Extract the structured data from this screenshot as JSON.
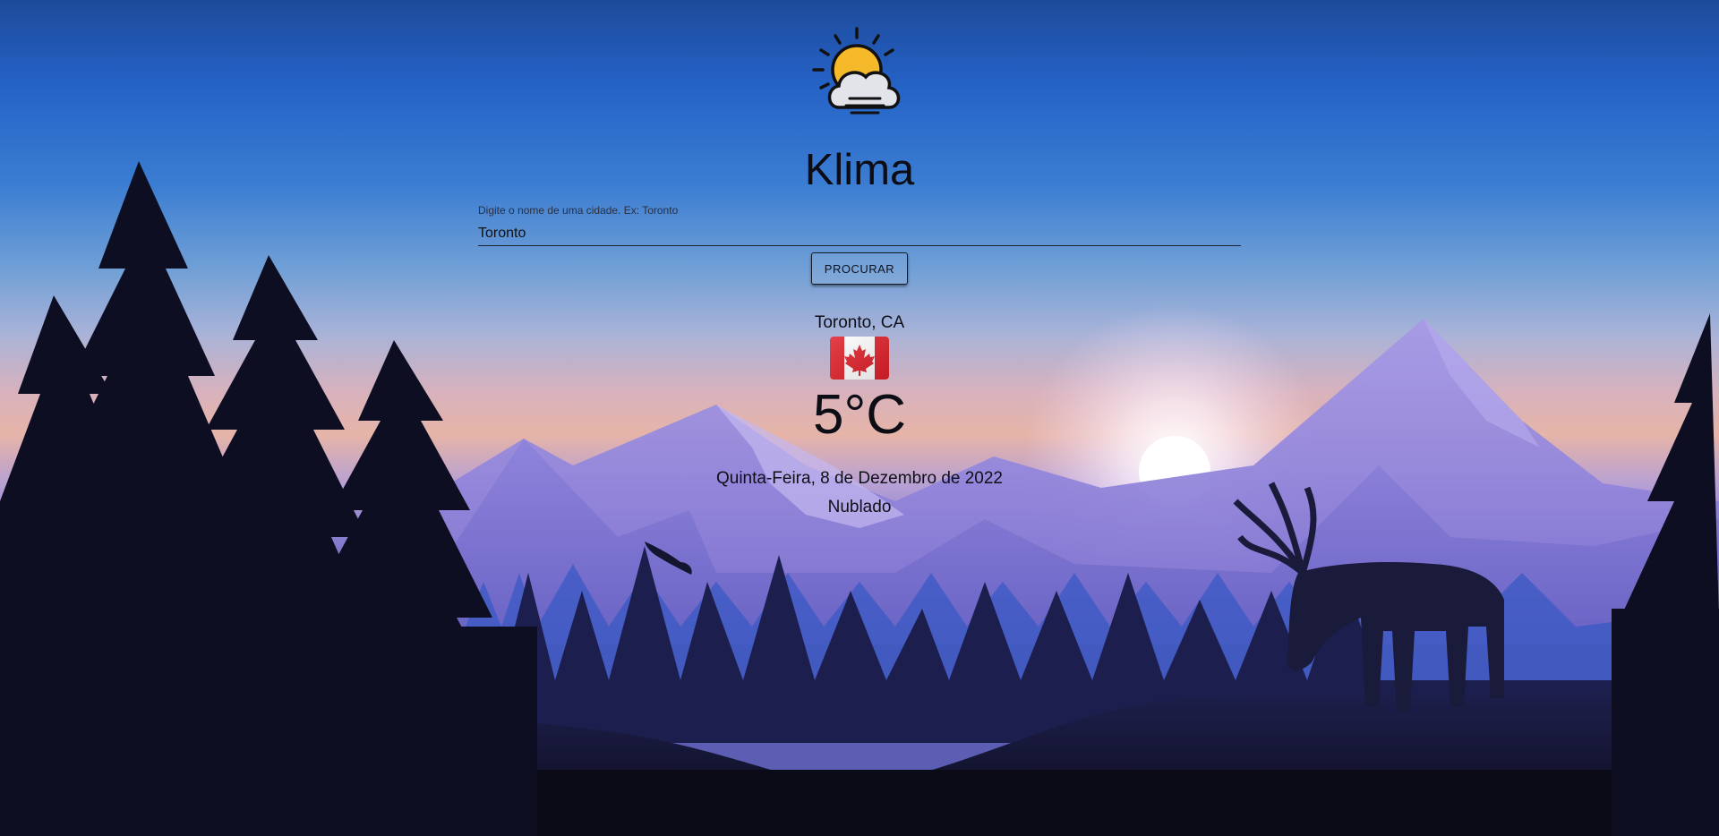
{
  "app": {
    "title": "Klima",
    "logo_icon": "partly-cloudy-icon"
  },
  "search": {
    "label": "Digite o nome de uma cidade. Ex: Toronto",
    "value": "Toronto",
    "button_label": "PROCURAR"
  },
  "weather": {
    "location": "Toronto, CA",
    "flag_icon": "canada-flag-icon",
    "temperature": "5°C",
    "date": "Quinta-Feira, 8 de Dezembro de 2022",
    "condition": "Nublado"
  },
  "colors": {
    "text": "#0f0f18",
    "sky_top": "#1e4a9a",
    "mountain": "#8a7fcf",
    "forest": "#0c0d1e"
  }
}
